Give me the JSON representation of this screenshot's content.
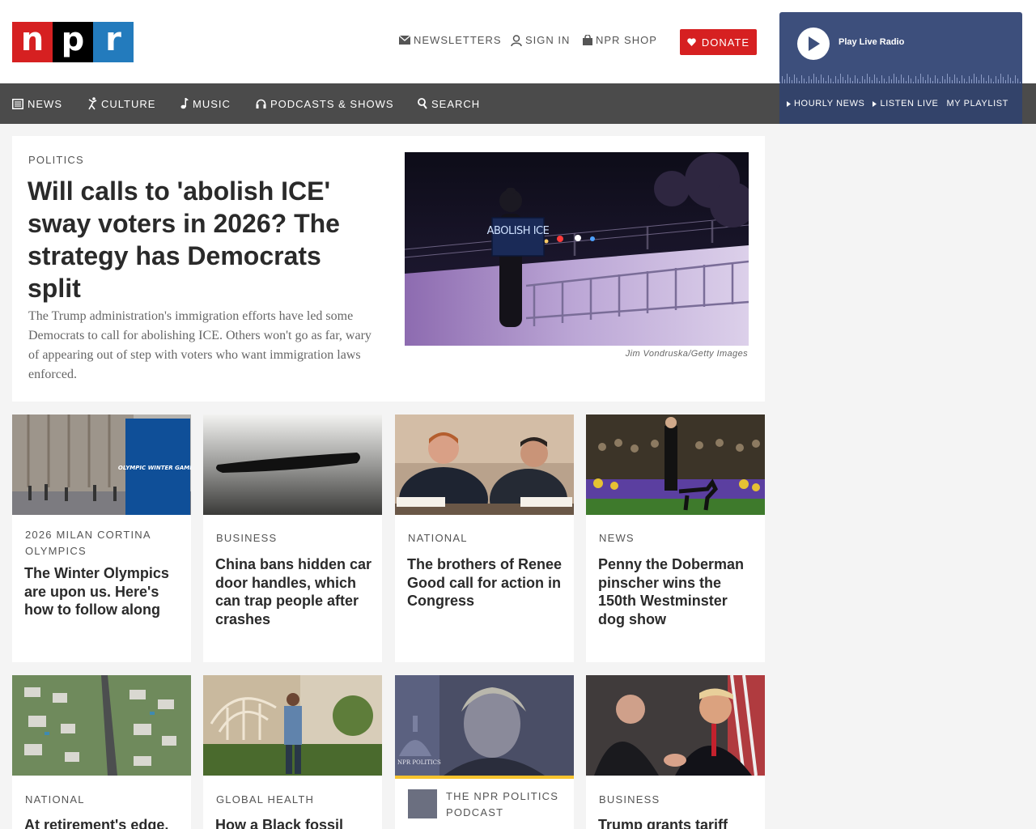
{
  "header": {
    "logo_letters": [
      "n",
      "p",
      "r"
    ],
    "utility": {
      "newsletters": "NEWSLETTERS",
      "sign_in": "SIGN IN",
      "shop": "NPR SHOP"
    },
    "donate": "DONATE"
  },
  "player": {
    "label": "Play Live Radio",
    "links": [
      "HOURLY NEWS",
      "LISTEN LIVE",
      "MY PLAYLIST"
    ]
  },
  "nav": {
    "news": "NEWS",
    "culture": "CULTURE",
    "music": "MUSIC",
    "podcasts": "PODCASTS & SHOWS",
    "search": "SEARCH"
  },
  "hero": {
    "slug": "POLITICS",
    "title": "Will calls to 'abolish ICE' sway voters in 2026? The strategy has Democrats split",
    "teaser": "The Trump administration's immigration efforts have led some Democrats to call for abolishing ICE. Others won't go as far, wary of appearing out of step with voters who want immigration laws enforced.",
    "sign_text": "ABOLISH ICE",
    "credit": "Jim Vondruska/Getty Images"
  },
  "cards": [
    {
      "slug": "2026 MILAN CORTINA OLYMPICS",
      "headline": "The Winter Olympics are upon us. Here's how to follow along",
      "banner": "OLYMPIC WINTER GAMES"
    },
    {
      "slug": "BUSINESS",
      "headline": "China bans hidden car door handles, which can trap people after crashes"
    },
    {
      "slug": "NATIONAL",
      "headline": "The brothers of Renee Good call for action in Congress"
    },
    {
      "slug": "NEWS",
      "headline": "Penny the Doberman pinscher wins the 150th Westminster dog show"
    },
    {
      "slug": "NATIONAL",
      "headline": "At retirement's edge,"
    },
    {
      "slug": "GLOBAL HEALTH",
      "headline": "How a Black fossil"
    },
    {
      "slug": "THE NPR POLITICS PODCAST",
      "headline": "",
      "img_text": "NPR POLITICS"
    },
    {
      "slug": "BUSINESS",
      "headline": "Trump grants tariff"
    }
  ],
  "colors": {
    "npr_red": "#d62021",
    "npr_blue": "#237bbd",
    "player_bg": "#3d4f7c",
    "nav_bg": "#4b4b4b",
    "podcast_accent": "#f7c32e"
  }
}
